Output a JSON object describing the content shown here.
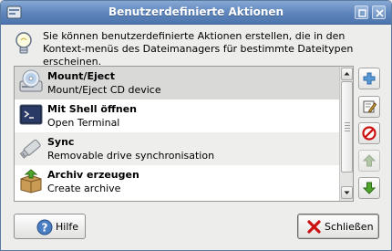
{
  "window": {
    "title": "Benutzerdefinierte Aktionen"
  },
  "info": {
    "text": "Sie können benutzerdefinierte Aktionen erstellen, die in den Kontext-menüs des Dateimanagers für bestimmte Dateitypen erscheinen."
  },
  "actions": [
    {
      "title": "Mount/Eject",
      "description": "Mount/Eject CD device",
      "icon": "cd-drive-icon"
    },
    {
      "title": "Mit Shell öffnen",
      "description": "Open Terminal",
      "icon": "terminal-icon"
    },
    {
      "title": "Sync",
      "description": "Removable drive synchronisation",
      "icon": "usb-stick-icon"
    },
    {
      "title": "Archiv erzeugen",
      "description": "Create archive",
      "icon": "archive-box-icon"
    }
  ],
  "side_buttons": [
    {
      "name": "add-action-button",
      "icon": "plus-icon",
      "enabled": true
    },
    {
      "name": "edit-action-button",
      "icon": "edit-icon",
      "enabled": true
    },
    {
      "name": "delete-action-button",
      "icon": "delete-icon",
      "enabled": true
    },
    {
      "name": "move-up-button",
      "icon": "arrow-up-icon",
      "enabled": false
    },
    {
      "name": "move-down-button",
      "icon": "arrow-down-icon",
      "enabled": true
    }
  ],
  "buttons": {
    "help_label": "Hilfe",
    "close_label": "Schließen"
  },
  "colors": {
    "titlebar": "#5d84bb",
    "selected_row": "#d9d9d8",
    "add_green": "#4a9a2a",
    "delete_red": "#cc1111"
  }
}
